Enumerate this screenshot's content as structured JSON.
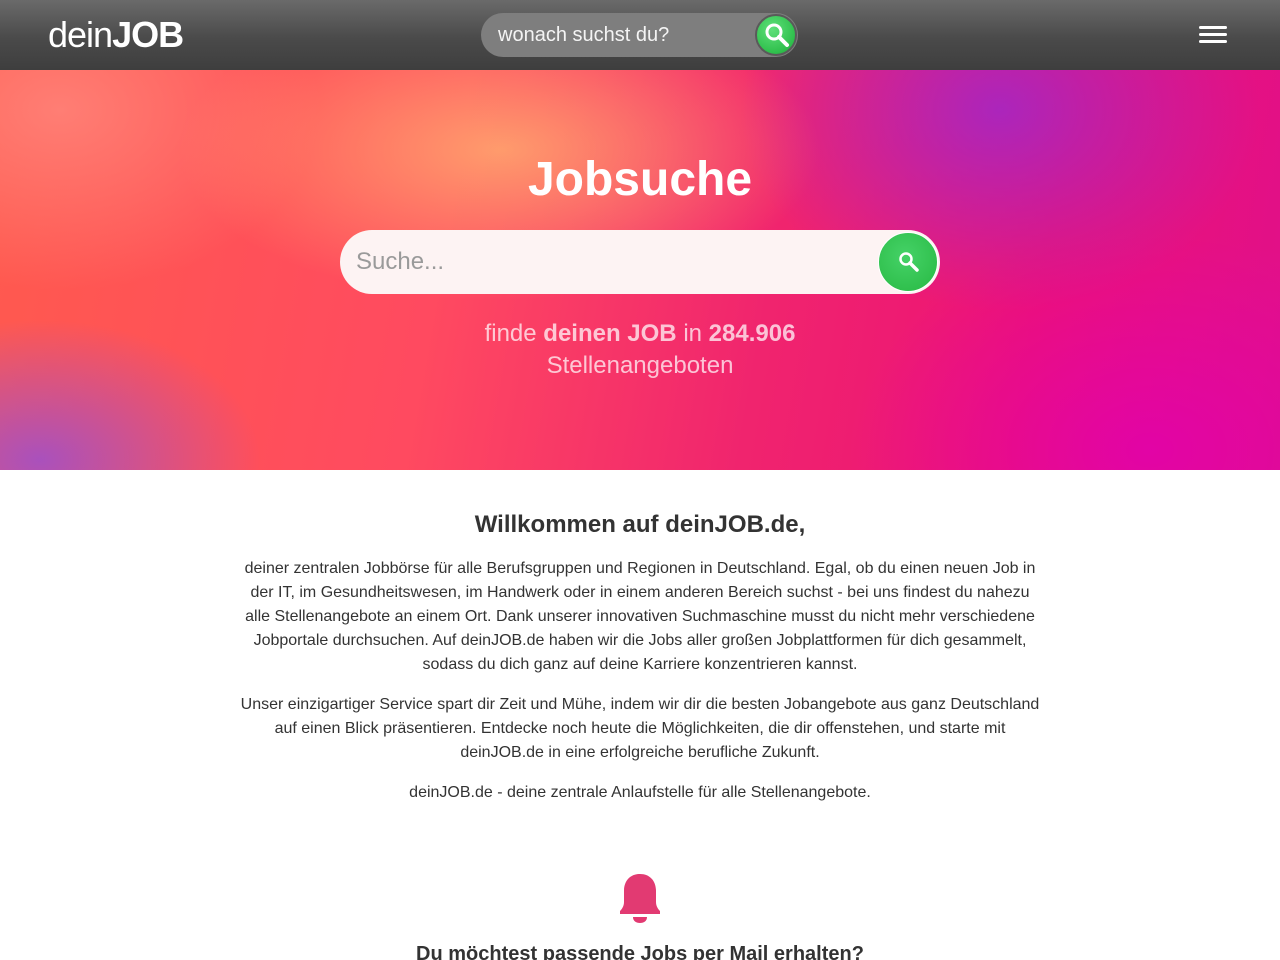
{
  "header": {
    "logo_light": "dein",
    "logo_bold": "JOB",
    "search_placeholder": "wonach suchst du?"
  },
  "hero": {
    "title": "Jobsuche",
    "search_placeholder": "Suche...",
    "count_prefix": "finde",
    "count_highlight": "deinen JOB",
    "count_middle": "in",
    "count_number": "284.906",
    "count_suffix": "Stellenangeboten"
  },
  "welcome": {
    "title": "Willkommen auf deinJOB.de,",
    "paragraph1": "deiner zentralen Jobbörse für alle Berufsgruppen und Regionen in Deutschland. Egal, ob du einen neuen Job in der IT, im Gesundheitswesen, im Handwerk oder in einem anderen Bereich suchst - bei uns findest du nahezu alle Stellenangebote an einem Ort. Dank unserer innovativen Suchmaschine musst du nicht mehr verschiedene Jobportale durchsuchen. Auf deinJOB.de haben wir die Jobs aller großen Jobplattformen für dich gesammelt, sodass du dich ganz auf deine Karriere konzentrieren kannst.",
    "paragraph2": "Unser einzigartiger Service spart dir Zeit und Mühe, indem wir dir die besten Jobangebote aus ganz Deutschland auf einen Blick präsentieren. Entdecke noch heute die Möglichkeiten, die dir offenstehen, und starte mit deinJOB.de in eine erfolgreiche berufliche Zukunft.",
    "paragraph3": "deinJOB.de - deine zentrale Anlaufstelle für alle Stellenangebote."
  },
  "job_alert": {
    "icon": "bell-icon",
    "title": "Du möchtest passende Jobs per Mail erhalten?"
  },
  "colors": {
    "accent_green": "#2fbf4c",
    "bell_pink": "#e23a72",
    "header_bg": "#4a4a4a"
  }
}
